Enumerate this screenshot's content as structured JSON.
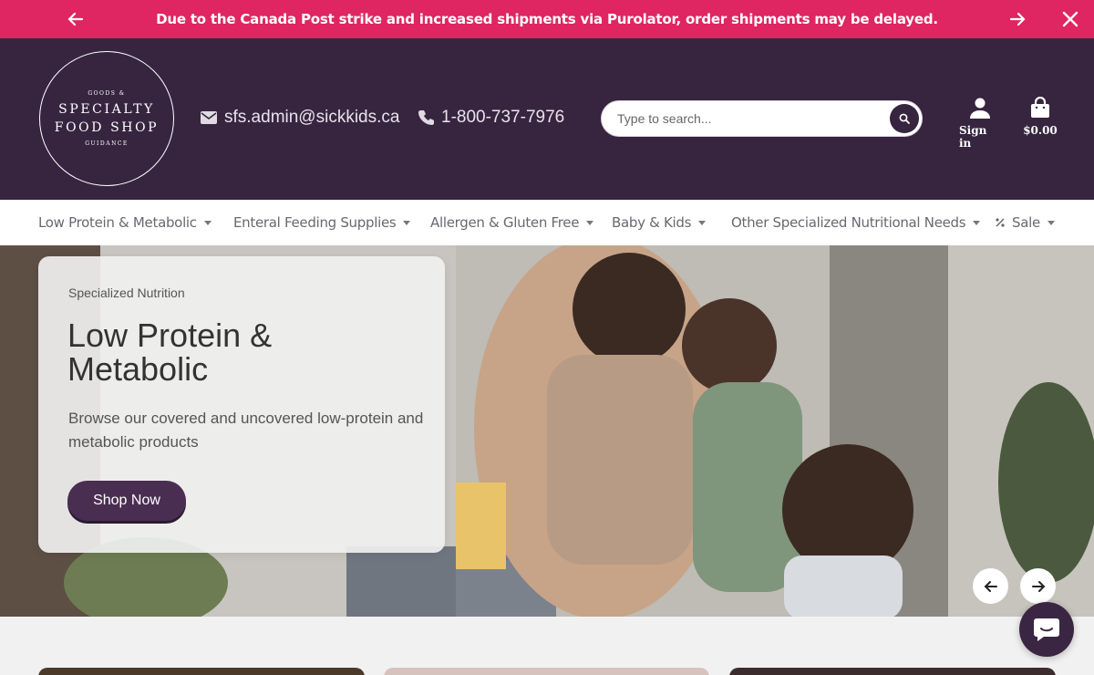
{
  "announcement": {
    "message": "Due to the Canada Post strike and increased shipments via Purolator, order shipments may be delayed."
  },
  "header": {
    "logo": {
      "top": "GOODS &",
      "line1": "SPECIALTY",
      "line2": "FOOD SHOP",
      "bottom": "GUIDANCE"
    },
    "email": "sfs.admin@sickkids.ca",
    "phone": "1-800-737-7976",
    "search": {
      "placeholder": "Type to search..."
    },
    "signin_label": "Sign in",
    "cart_total": "$0.00"
  },
  "nav": {
    "items": [
      {
        "label": "Low Protein & Metabolic"
      },
      {
        "label": "Enteral Feeding Supplies"
      },
      {
        "label": "Allergen & Gluten Free"
      },
      {
        "label": "Baby & Kids"
      },
      {
        "label": "Other Specialized Nutritional Needs"
      },
      {
        "label": "Sale"
      }
    ]
  },
  "hero": {
    "eyebrow": "Specialized Nutrition",
    "title": "Low Protein & Metabolic",
    "description": "Browse our covered and uncovered low-protein and metabolic products",
    "button_label": "Shop Now"
  },
  "colors": {
    "announcement_bg": "#df2562",
    "header_bg": "#372540",
    "button_bg": "#4a2e52"
  }
}
